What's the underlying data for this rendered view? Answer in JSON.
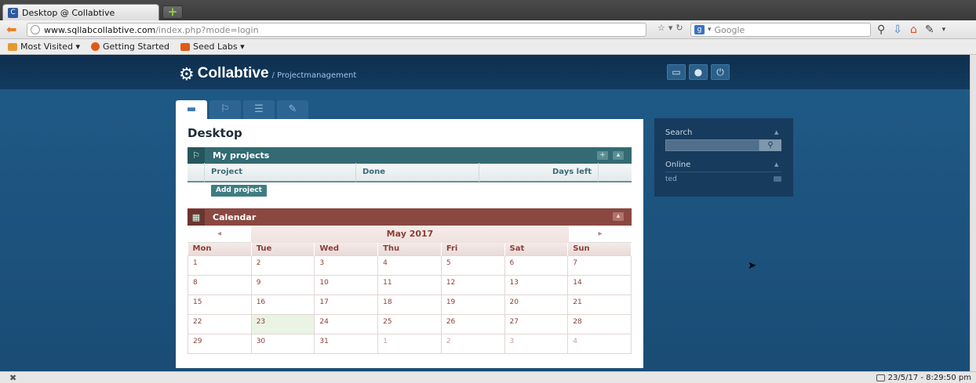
{
  "browser": {
    "tab_title": "Desktop @ Collabtive",
    "new_tab_symbol": "+",
    "url_host": "www.sqllabcollabtive.com",
    "url_path": "/index.php?mode=login",
    "search_placeholder": "Google",
    "bookmarks": [
      "Most Visited ▾",
      "Getting Started",
      "Seed Labs ▾"
    ]
  },
  "app": {
    "name": "Collabtive",
    "subtitle": "/ Projectmanagement",
    "page_title": "Desktop"
  },
  "projects": {
    "title": "My projects",
    "columns": [
      "Project",
      "Done",
      "Days left"
    ],
    "add_button": "Add project"
  },
  "calendar": {
    "title": "Calendar",
    "month": "May 2017",
    "prev": "◂",
    "next": "▸",
    "days": [
      "Mon",
      "Tue",
      "Wed",
      "Thu",
      "Fri",
      "Sat",
      "Sun"
    ],
    "weeks": [
      [
        "1",
        "2",
        "3",
        "4",
        "5",
        "6",
        "7"
      ],
      [
        "8",
        "9",
        "10",
        "11",
        "12",
        "13",
        "14"
      ],
      [
        "15",
        "16",
        "17",
        "18",
        "19",
        "20",
        "21"
      ],
      [
        "22",
        "23",
        "24",
        "25",
        "26",
        "27",
        "28"
      ],
      [
        "29",
        "30",
        "31",
        "1",
        "2",
        "3",
        "4"
      ]
    ]
  },
  "sidebar": {
    "search_title": "Search",
    "online_title": "Online",
    "online_user": "ted"
  },
  "status": {
    "clock": "23/5/17 - 8:29:50 pm"
  }
}
